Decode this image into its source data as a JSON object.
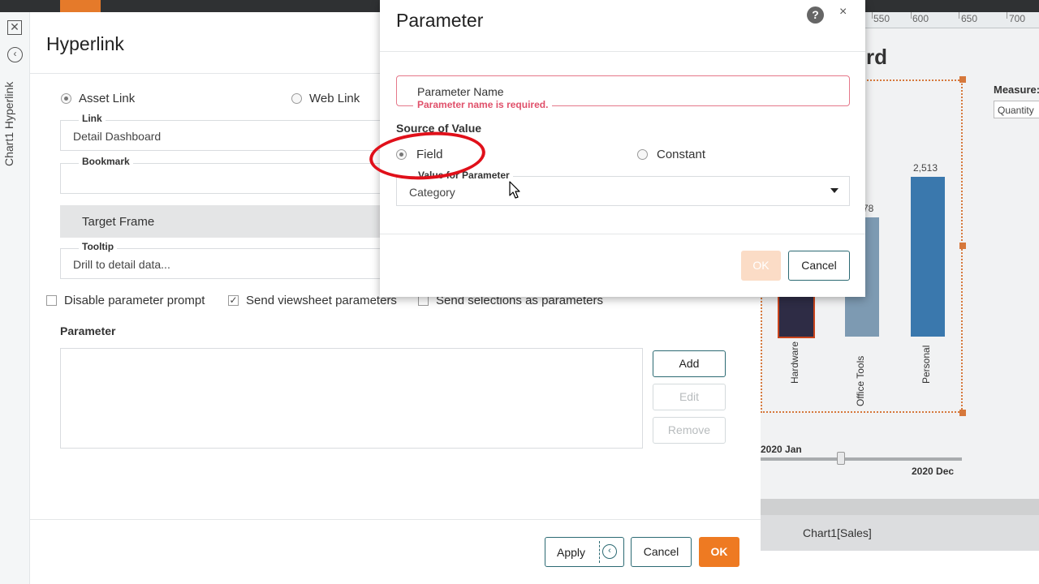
{
  "sidebar": {
    "vertical_label": "Chart1 Hyperlink"
  },
  "hyperlink": {
    "title": "Hyperlink",
    "link_type": {
      "asset": "Asset Link",
      "web": "Web Link",
      "selected": "asset"
    },
    "link": {
      "label": "Link",
      "value": "Detail Dashboard"
    },
    "bookmark": {
      "label": "Bookmark",
      "value": ""
    },
    "target_frame": "Target Frame",
    "tooltip": {
      "label": "Tooltip",
      "value": "Drill to detail data..."
    },
    "checkboxes": {
      "disable_prompt": {
        "label": "Disable parameter prompt",
        "checked": false
      },
      "send_viewsheet": {
        "label": "Send viewsheet parameters",
        "checked": true
      },
      "send_selections": {
        "label": "Send selections as parameters",
        "checked": false
      }
    },
    "parameter_heading": "Parameter",
    "side_buttons": {
      "add": "Add",
      "edit": "Edit",
      "remove": "Remove"
    },
    "footer": {
      "apply": "Apply",
      "cancel": "Cancel",
      "ok": "OK"
    }
  },
  "modal": {
    "title": "Parameter",
    "help_glyph": "?",
    "close_glyph": "×",
    "name_placeholder": "Parameter Name",
    "name_error": "Parameter name is required.",
    "source_label": "Source of Value",
    "field_option": "Field",
    "constant_option": "Constant",
    "selected_source": "field",
    "value_label": "Value for Parameter",
    "value_selected": "Category",
    "ok": "OK",
    "cancel": "Cancel"
  },
  "background": {
    "ruler_labels": [
      "550",
      "600",
      "650",
      "700"
    ],
    "title_fragment": "rd",
    "measure_label": "Measure:",
    "measure_value": "Quantity",
    "tab_label": "Chart1[Sales]",
    "slider": {
      "start": "2020 Jan",
      "end": "2020 Dec"
    }
  },
  "chart_data": {
    "type": "bar",
    "categories": [
      "Hardware",
      "Office Tools",
      "Personal"
    ],
    "value_labels": [
      "",
      "78",
      "2,513"
    ],
    "colors": [
      "#2e2c45",
      "#7d9ab2",
      "#3a78ad"
    ]
  }
}
